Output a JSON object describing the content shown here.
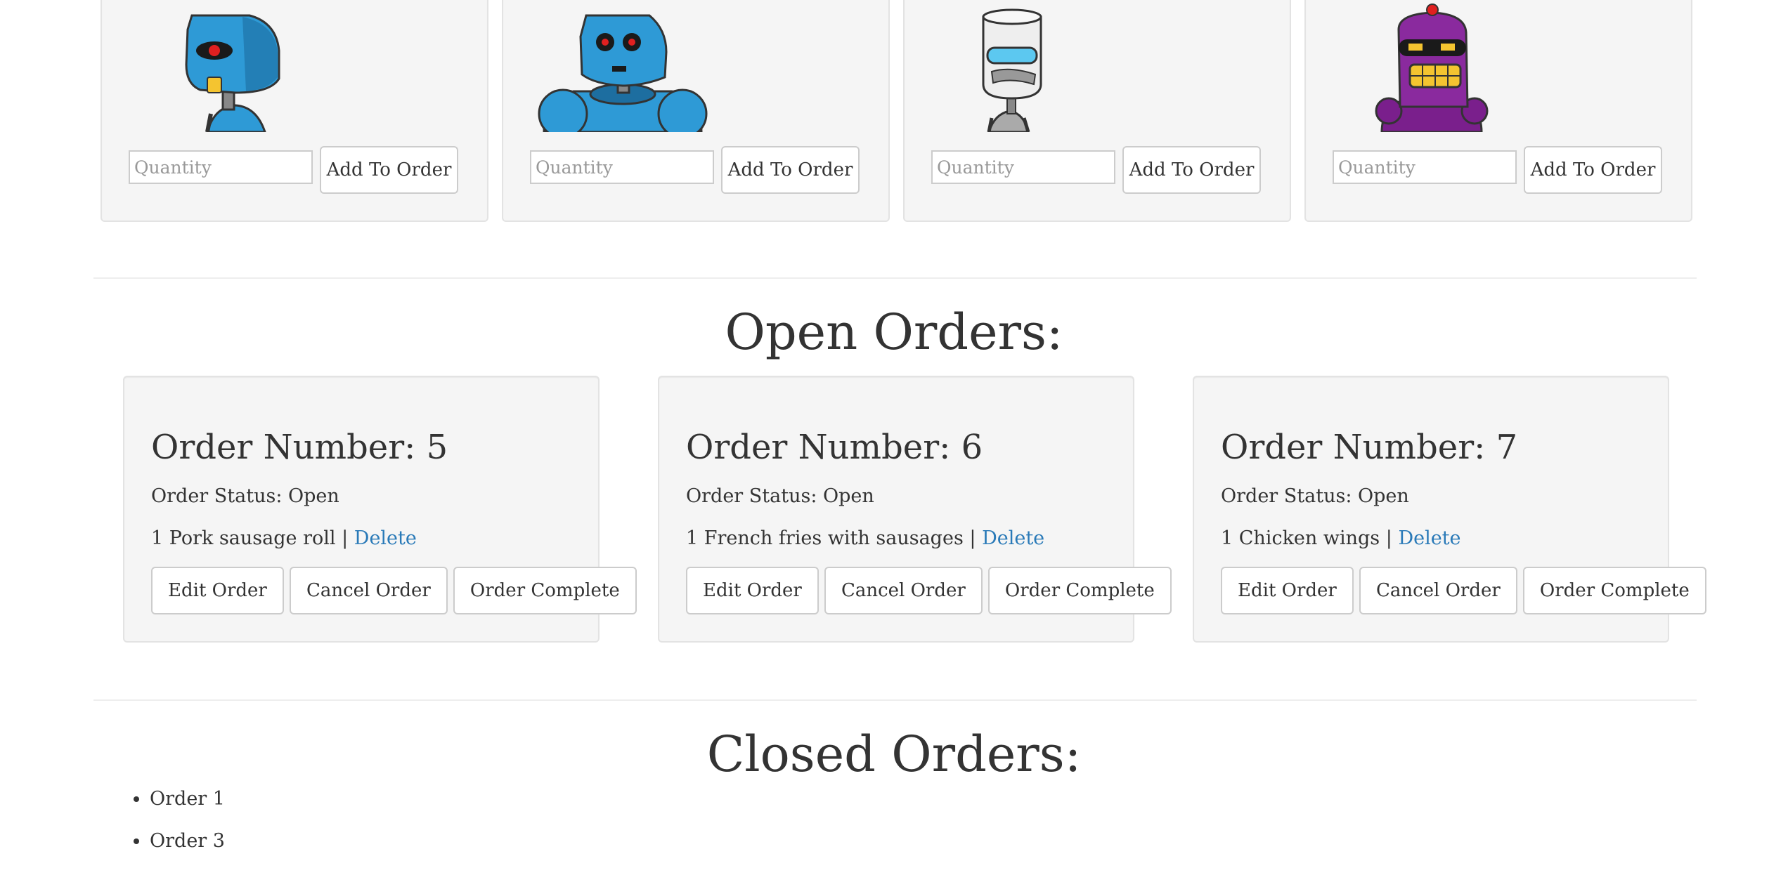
{
  "products": [
    {
      "name": "robot-cyclops",
      "placeholder": "Quantity",
      "button": "Add To Order"
    },
    {
      "name": "robot-blue-big",
      "placeholder": "Quantity",
      "button": "Add To Order"
    },
    {
      "name": "robot-white-tin",
      "placeholder": "Quantity",
      "button": "Add To Order"
    },
    {
      "name": "robot-purple",
      "placeholder": "Quantity",
      "button": "Add To Order"
    }
  ],
  "open_orders": {
    "heading": "Open Orders:",
    "orders": [
      {
        "title": "Order Number: 5",
        "status": "Order Status: Open",
        "item_text": "1 Pork sausage roll |",
        "delete_label": "Delete",
        "edit_label": "Edit Order",
        "cancel_label": "Cancel Order",
        "complete_label": "Order Complete"
      },
      {
        "title": "Order Number: 6",
        "status": "Order Status: Open",
        "item_text": "1 French fries with sausages |",
        "delete_label": "Delete",
        "edit_label": "Edit Order",
        "cancel_label": "Cancel Order",
        "complete_label": "Order Complete"
      },
      {
        "title": "Order Number: 7",
        "status": "Order Status: Open",
        "item_text": "1 Chicken wings |",
        "delete_label": "Delete",
        "edit_label": "Edit Order",
        "cancel_label": "Cancel Order",
        "complete_label": "Order Complete"
      }
    ]
  },
  "closed_orders": {
    "heading": "Closed Orders:",
    "items": [
      "Order 1",
      "Order 3"
    ]
  },
  "colors": {
    "link": "#2a7ab8",
    "card_bg": "#f5f5f5",
    "card_border": "#e3e3e3",
    "robot_blue": "#2e9ad6",
    "robot_purple": "#7a1f8c"
  }
}
